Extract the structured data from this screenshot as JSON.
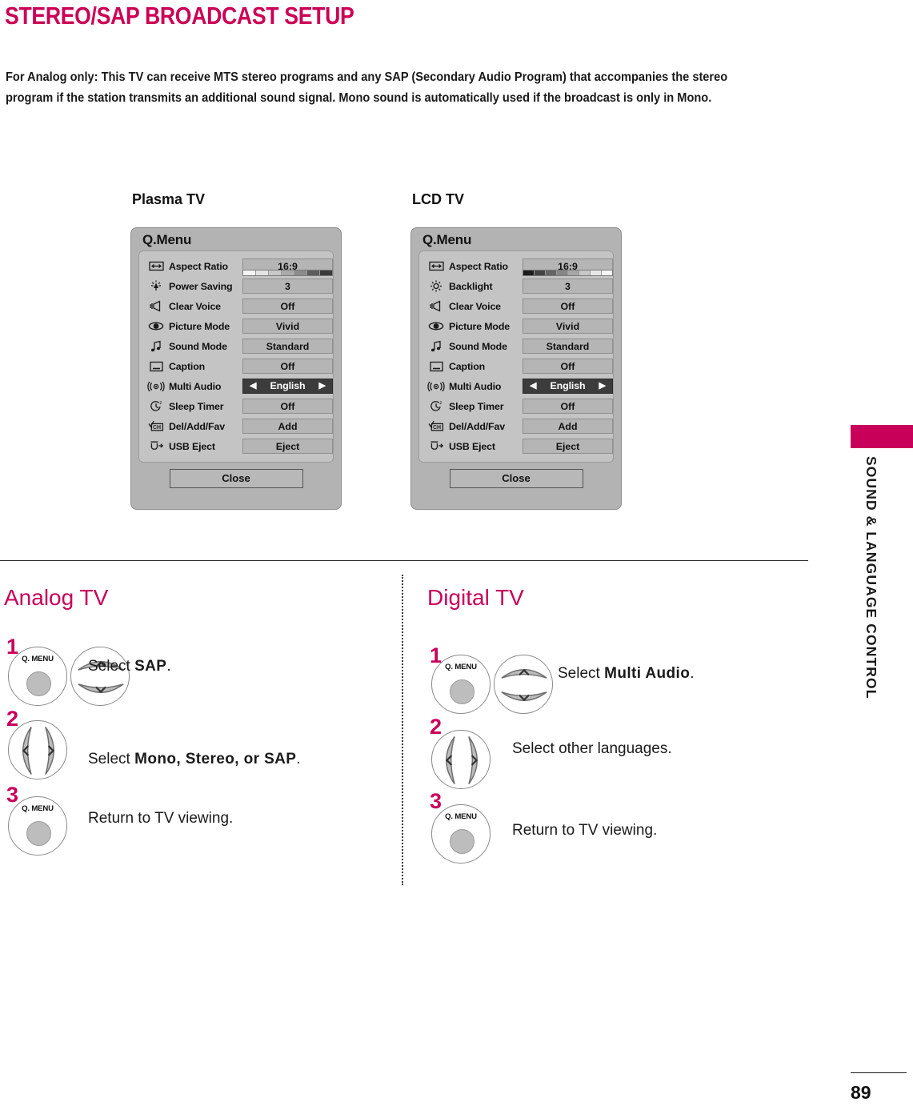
{
  "page": {
    "title": "STEREO/SAP BROADCAST SETUP",
    "intro": "For Analog only: This TV can receive MTS stereo programs and any SAP (Secondary Audio Program) that accompanies the stereo program if the station transmits an additional sound signal. Mono sound is automatically used if the broadcast is only in Mono.",
    "number": "89",
    "side_tab_label": "SOUND & LANGUAGE CONTROL",
    "accent_color": "#c8005a",
    "heading_color": "#cc0055"
  },
  "panels": {
    "plasma": {
      "caption": "Plasma TV",
      "menu_title": "Q.Menu",
      "close_label": "Close",
      "strip_direction": "light-to-dark",
      "rows": [
        {
          "icon": "aspect-ratio-icon",
          "label": "Aspect Ratio",
          "value": "16:9",
          "selected": false,
          "strip": false
        },
        {
          "icon": "power-saving-icon",
          "label": "Power Saving",
          "value": "3",
          "selected": false,
          "strip": true
        },
        {
          "icon": "clear-voice-icon",
          "label": "Clear Voice",
          "value": "Off",
          "selected": false,
          "strip": false
        },
        {
          "icon": "picture-mode-icon",
          "label": "Picture Mode",
          "value": "Vivid",
          "selected": false,
          "strip": false
        },
        {
          "icon": "sound-mode-icon",
          "label": "Sound Mode",
          "value": "Standard",
          "selected": false,
          "strip": false
        },
        {
          "icon": "caption-icon",
          "label": "Caption",
          "value": "Off",
          "selected": false,
          "strip": false
        },
        {
          "icon": "multi-audio-icon",
          "label": "Multi Audio",
          "value": "English",
          "selected": true,
          "strip": false
        },
        {
          "icon": "sleep-timer-icon",
          "label": "Sleep Timer",
          "value": "Off",
          "selected": false,
          "strip": false
        },
        {
          "icon": "channel-icon",
          "label": "Del/Add/Fav",
          "value": "Add",
          "selected": false,
          "strip": false
        },
        {
          "icon": "usb-eject-icon",
          "label": "USB Eject",
          "value": "Eject",
          "selected": false,
          "strip": false
        }
      ]
    },
    "lcd": {
      "caption": "LCD TV",
      "menu_title": "Q.Menu",
      "close_label": "Close",
      "strip_direction": "dark-to-light",
      "rows": [
        {
          "icon": "aspect-ratio-icon",
          "label": "Aspect Ratio",
          "value": "16:9",
          "selected": false,
          "strip": false
        },
        {
          "icon": "backlight-icon",
          "label": "Backlight",
          "value": "3",
          "selected": false,
          "strip": true
        },
        {
          "icon": "clear-voice-icon",
          "label": "Clear Voice",
          "value": "Off",
          "selected": false,
          "strip": false
        },
        {
          "icon": "picture-mode-icon",
          "label": "Picture Mode",
          "value": "Vivid",
          "selected": false,
          "strip": false
        },
        {
          "icon": "sound-mode-icon",
          "label": "Sound Mode",
          "value": "Standard",
          "selected": false,
          "strip": false
        },
        {
          "icon": "caption-icon",
          "label": "Caption",
          "value": "Off",
          "selected": false,
          "strip": false
        },
        {
          "icon": "multi-audio-icon",
          "label": "Multi Audio",
          "value": "English",
          "selected": true,
          "strip": false
        },
        {
          "icon": "sleep-timer-icon",
          "label": "Sleep Timer",
          "value": "Off",
          "selected": false,
          "strip": false
        },
        {
          "icon": "channel-icon",
          "label": "Del/Add/Fav",
          "value": "Add",
          "selected": false,
          "strip": false
        },
        {
          "icon": "usb-eject-icon",
          "label": "USB Eject",
          "value": "Eject",
          "selected": false,
          "strip": false
        }
      ]
    }
  },
  "analog": {
    "heading": "Analog TV",
    "steps": [
      {
        "num": "1",
        "buttons": [
          "qmenu-button",
          "updown-button"
        ],
        "button_label": "Q. MENU",
        "text_prefix": "Select ",
        "text_bold": "SAP",
        "text_suffix": "."
      },
      {
        "num": "2",
        "buttons": [
          "leftright-button"
        ],
        "button_label": "",
        "text_prefix": "Select ",
        "text_bold": "Mono, Stereo, or SAP",
        "text_suffix": "."
      },
      {
        "num": "3",
        "buttons": [
          "qmenu-button"
        ],
        "button_label": "Q. MENU",
        "text_prefix": "Return to TV viewing.",
        "text_bold": "",
        "text_suffix": ""
      }
    ]
  },
  "digital": {
    "heading": "Digital TV",
    "steps": [
      {
        "num": "1",
        "buttons": [
          "qmenu-button",
          "updown-button"
        ],
        "button_label": "Q. MENU",
        "text_prefix": "Select ",
        "text_bold": "Multi Audio",
        "text_suffix": "."
      },
      {
        "num": "2",
        "buttons": [
          "leftright-button"
        ],
        "button_label": "",
        "text_prefix": "Select other languages.",
        "text_bold": "",
        "text_suffix": ""
      },
      {
        "num": "3",
        "buttons": [
          "qmenu-button"
        ],
        "button_label": "Q. MENU",
        "text_prefix": "Return to TV viewing.",
        "text_bold": "",
        "text_suffix": ""
      }
    ]
  }
}
